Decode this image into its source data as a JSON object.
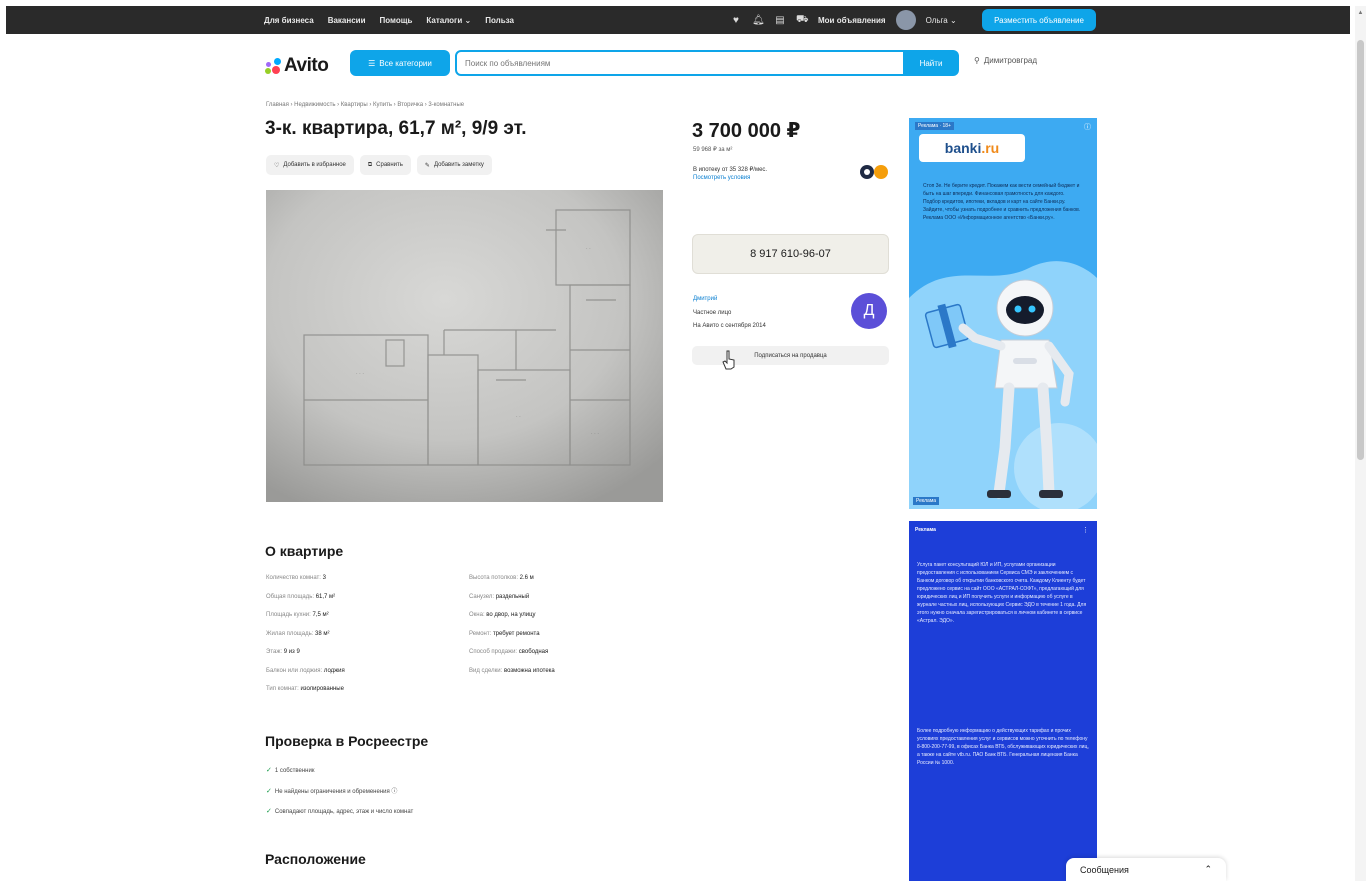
{
  "topbar": {
    "nav": [
      "Для бизнеса",
      "Вакансии",
      "Помощь",
      "Каталоги ⌄",
      "Польза"
    ],
    "my_ads": "Мои объявления",
    "user": "Ольга ⌄",
    "post_button": "Разместить объявление"
  },
  "header": {
    "logo": "Avito",
    "categories_button": "Все категории",
    "search_placeholder": "Поиск по объявлениям",
    "search_button": "Найти",
    "location": "Димитровград"
  },
  "breadcrumb": "Главная › Недвижимость › Квартиры › Купить › Вторичка › 3-комнатные",
  "listing": {
    "title": "3-к. квартира, 61,7 м², 9/9 эт.",
    "actions": [
      "Добавить в избранное",
      "Сравнить",
      "Добавить заметку"
    ],
    "price": "3 700 000 ₽",
    "price_per_m": "59 968 ₽ за м²",
    "mortgage": "В ипотеку от 35 328 ₽/мес.",
    "mortgage_link": "Посмотреть условия",
    "phone": "8 917 610-96-07",
    "seller": {
      "name": "Дмитрий",
      "type": "Частное лицо",
      "since": "На Авито с сентября 2014",
      "avatar_letter": "Д"
    },
    "subscribe": "Подписаться на продавца"
  },
  "about": {
    "title": "О квартире",
    "left": [
      {
        "k": "Количество комнат:",
        "v": "3"
      },
      {
        "k": "Общая площадь:",
        "v": "61,7 м²"
      },
      {
        "k": "Площадь кухни:",
        "v": "7,5 м²"
      },
      {
        "k": "Жилая площадь:",
        "v": "38 м²"
      },
      {
        "k": "Этаж:",
        "v": "9 из 9"
      },
      {
        "k": "Балкон или лоджия:",
        "v": "лоджия"
      },
      {
        "k": "Тип комнат:",
        "v": "изолированные"
      }
    ],
    "right": [
      {
        "k": "Высота потолков:",
        "v": "2.6 м"
      },
      {
        "k": "Санузел:",
        "v": "раздельный"
      },
      {
        "k": "Окна:",
        "v": "во двор, на улицу"
      },
      {
        "k": "Ремонт:",
        "v": "требует ремонта"
      },
      {
        "k": "Способ продажи:",
        "v": "свободная"
      },
      {
        "k": "Вид сделки:",
        "v": "возможна ипотека"
      }
    ]
  },
  "rosreestr": {
    "title": "Проверка в Росреестре",
    "items": [
      "1 собственник",
      "Не найдены ограничения и обременения ⓘ",
      "Совпадают площадь, адрес, этаж и число комнат"
    ]
  },
  "location_section": {
    "title": "Расположение"
  },
  "ad1": {
    "label": "Реклама · 18+",
    "brand_main": "banki",
    "brand_suffix": ".ru",
    "text": "Стоп 3е. Не берите кредит. Покажем как вести семейный бюджет и быть на шаг впереди. Финансовая грамотность для каждого. Подбор кредитов, ипотеки, вкладов и карт на сайте Банки.ру. Зайдите, чтобы узнать подробнее и сравнить предложения банков. Реклама ООО «Информационное агентство «Банки.ру».",
    "footer_label": "Реклама"
  },
  "ad2": {
    "label": "Реклама",
    "p1": "Услуга пакет консультаций ЮЛ и ИП, услугами организации предоставления с использованием Сервиса СМЭ и заключением с Банком договор об открытии банковского счета. Каждому Клиенту будет предложено сервис на сайт ООО «АСТРАЛ-СОФТ», предлагающий для юридических лиц и ИП получить услуги и информацию об услуге в журнале частных лиц, использующих Сервис ЭДО в течение 1 года. Для этого нужно сначала зарегистрироваться в личном кабинете в сервисе «Астрал. ЭДО».",
    "p2": "Более подробную информацию о действующих тарифах и прочих условиях предоставления услуг и сервисов можно уточнить по телефону 8-800-200-77-99, в офисах Банка ВТБ, обслуживающих юридических лиц, а также на сайте vtb.ru. ПАО Банк ВТБ. Генеральная лицензия Банка России № 1000."
  },
  "messages": {
    "label": "Сообщения",
    "chevron": "⌃"
  },
  "colors": {
    "accent": "#0ea5e9",
    "dark": "#2a2a2a",
    "seller_avatar": "#5b4fd8"
  }
}
